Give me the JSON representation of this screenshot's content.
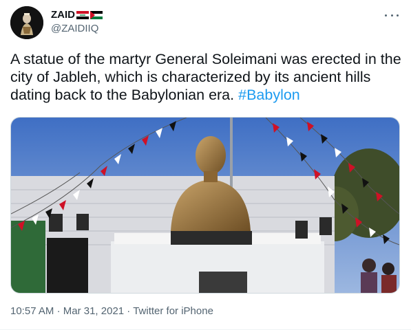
{
  "author": {
    "display_name": "ZAID",
    "handle": "@ZAIDIIQ",
    "flags": [
      "iraq-flag-icon",
      "palestine-flag-icon"
    ]
  },
  "tweet": {
    "text": "A statue of the martyr General Soleimani was erected in the city of Jableh, which is characterized by its ancient hills dating back to the Babylonian era.",
    "hashtag": "#Babylon"
  },
  "meta": {
    "time": "10:57 AM",
    "date": "Mar 31, 2021",
    "source": "Twitter for iPhone",
    "separator": "·"
  },
  "colors": {
    "link": "#1d9bf0",
    "secondary_text": "#536471",
    "primary_text": "#0f1419"
  }
}
